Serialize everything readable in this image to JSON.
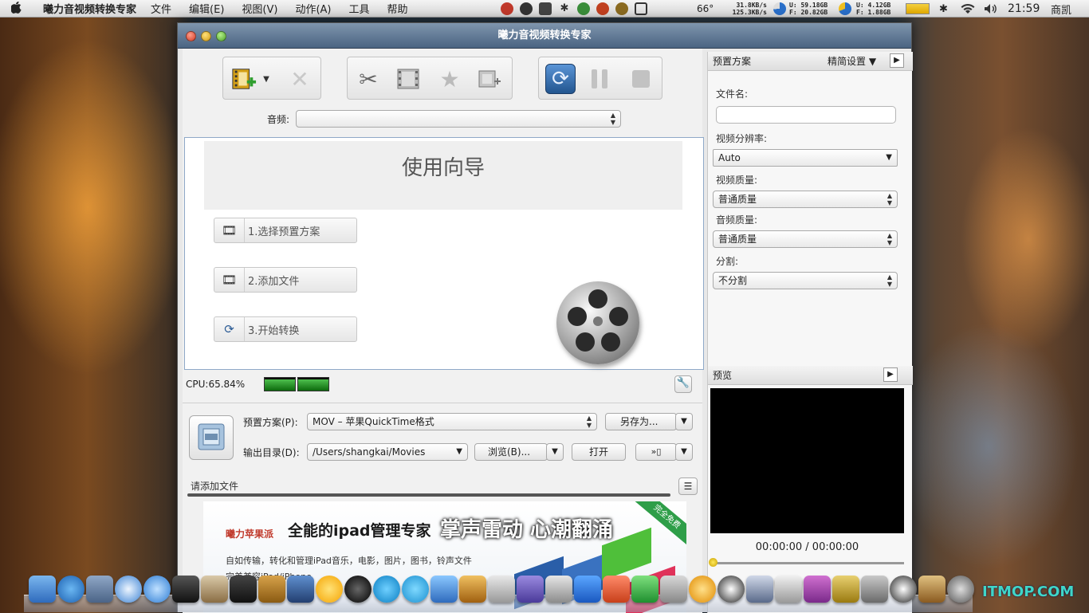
{
  "menubar": {
    "apple": "",
    "app_name": "曦力音视频转换专家",
    "items": [
      "文件",
      "编辑(E)",
      "视图(V)",
      "动作(A)",
      "工具",
      "帮助"
    ],
    "temperature": "66°",
    "net_up": "31.8KB/s",
    "net_down": "125.3KB/s",
    "disk1_used": "U: 59.18GB",
    "disk1_free": "F: 20.82GB",
    "mem_used": "U: 4.12GB",
    "mem_free": "F: 1.88GB",
    "clock": "21:59",
    "user": "商凯"
  },
  "window": {
    "title": "曦力音视频转换专家"
  },
  "audio": {
    "label": "音频:",
    "value": ""
  },
  "wizard": {
    "title": "使用向导",
    "steps": [
      {
        "label": "1.选择预置方案"
      },
      {
        "label": "2.添加文件"
      },
      {
        "label": "3.开始转换"
      }
    ]
  },
  "status": {
    "cpu": "CPU:65.84%",
    "meter_levels": [
      0.85,
      0.9
    ]
  },
  "output": {
    "preset_label": "预置方案(P):",
    "preset_value": "MOV – 苹果QuickTime格式",
    "save_as": "另存为...",
    "dir_label": "输出目录(D):",
    "dir_value": "/Users/shangkai/Movies",
    "browse": "浏览(B)...",
    "open": "打开"
  },
  "filelist": {
    "header": "请添加文件"
  },
  "ad": {
    "brand": "曦力苹果派",
    "headline": "全能的ipad管理专家",
    "line1": "自如传输，转化和管理iPad音乐，电影，图片，图书，铃声文件",
    "line2": "完美兼容iPod/iPhone",
    "badge": "完全免费"
  },
  "overlay": {
    "text": "掌声雷动 心潮翻涌"
  },
  "right_panel": {
    "preset_header": "预置方案",
    "advanced": "精简设置",
    "filename_label": "文件名:",
    "filename_value": "",
    "resolution_label": "视频分辨率:",
    "resolution_value": "Auto",
    "video_quality_label": "视频质量:",
    "video_quality_value": "普通质量",
    "audio_quality_label": "音频质量:",
    "audio_quality_value": "普通质量",
    "split_label": "分割:",
    "split_value": "不分割",
    "preview_header": "预览",
    "timecode": "00:00:00 / 00:00:00",
    "playback_position": 0
  },
  "watermark": "ITMOP.COM"
}
